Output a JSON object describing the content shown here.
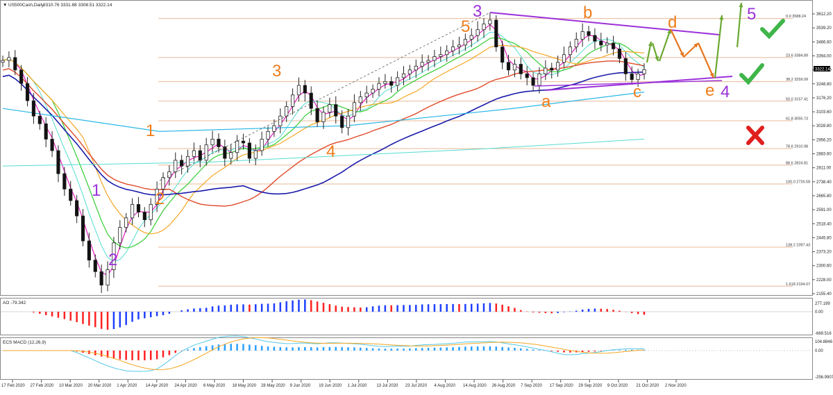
{
  "chart_data": {
    "type": "candlestick",
    "header": {
      "symbol": "US500Cash,Daily",
      "ohlc": "3310.76 3331.88 3308.51 3322.14"
    },
    "last_price": "3322.14",
    "y_ticks": [
      "3612.20",
      "3539.20",
      "3466.60",
      "3394.00",
      "3321.40",
      "3248.80",
      "3176.20",
      "3103.60",
      "3028.80",
      "2956.20",
      "2883.60",
      "2811.00",
      "2738.40",
      "2665.80",
      "2591.00",
      "2518.40",
      "2445.80",
      "2373.20",
      "2300.60",
      "2228.00",
      "2155.40"
    ],
    "ylim": [
      2155.4,
      3612.2
    ],
    "x_ticks": [
      "17 Feb 2020",
      "27 Feb 2020",
      "10 Mar 2020",
      "20 Mar 2020",
      "1 Apr 2020",
      "14 Apr 2020",
      "24 Apr 2020",
      "6 May 2020",
      "18 May 2020",
      "28 May 2020",
      "9 Jun 2020",
      "19 Jun 2020",
      "1 Jul 2020",
      "13 Jul 2020",
      "23 Jul 2020",
      "4 Aug 2020",
      "14 Aug 2020",
      "26 Aug 2020",
      "7 Sep 2020",
      "17 Sep 2020",
      "29 Sep 2020",
      "9 Oct 2020",
      "21 Oct 2020",
      "2 Nov 2020"
    ],
    "fib_levels": [
      {
        "label": "0.0 3588.24",
        "value": 3588.24
      },
      {
        "label": "23.6 3384.89",
        "value": 3384.89
      },
      {
        "label": "38.2 3259.09",
        "value": 3259.09
      },
      {
        "label": "50.0 3157.41",
        "value": 3157.41
      },
      {
        "label": "61.8 3055.73",
        "value": 3055.73
      },
      {
        "label": "78.6 2910.98",
        "value": 2910.98
      },
      {
        "label": "88.6 2824.81",
        "value": 2824.81
      },
      {
        "label": "100.0 2726.58",
        "value": 2726.58
      },
      {
        "label": "138.2 2397.43",
        "value": 2397.43
      },
      {
        "label": "1.618 2194.07",
        "value": 2194.07
      }
    ],
    "price_path": [
      3370,
      3385,
      3320,
      3250,
      3160,
      3080,
      3040,
      2960,
      2900,
      2780,
      2700,
      2640,
      2560,
      2430,
      2330,
      2270,
      2200,
      2280,
      2420,
      2500,
      2550,
      2620,
      2580,
      2540,
      2620,
      2700,
      2760,
      2790,
      2850,
      2820,
      2870,
      2900,
      2850,
      2930,
      2960,
      2920,
      2860,
      2890,
      2950,
      2940,
      2860,
      2900,
      2960,
      3000,
      3030,
      3080,
      3130,
      3190,
      3240,
      3200,
      3120,
      3050,
      3100,
      3140,
      3080,
      3020,
      3080,
      3150,
      3180,
      3200,
      3220,
      3250,
      3260,
      3240,
      3280,
      3300,
      3320,
      3340,
      3360,
      3370,
      3390,
      3400,
      3420,
      3440,
      3450,
      3480,
      3500,
      3530,
      3560,
      3580,
      3440,
      3360,
      3320,
      3350,
      3300,
      3280,
      3240,
      3300,
      3330,
      3320,
      3360,
      3400,
      3440,
      3480,
      3520,
      3500,
      3470,
      3450,
      3460,
      3430,
      3380,
      3300,
      3270,
      3300,
      3322
    ],
    "waves": [
      {
        "text": "1",
        "color": "#9b30d9"
      },
      {
        "text": "2",
        "color": "#9b30d9"
      },
      {
        "text": "1",
        "color": "#ee7d1b"
      },
      {
        "text": "2",
        "color": "#ee7d1b"
      },
      {
        "text": "3",
        "color": "#ee7d1b"
      },
      {
        "text": "4",
        "color": "#ee7d1b"
      },
      {
        "text": "5",
        "color": "#ee7d1b"
      },
      {
        "text": "3",
        "color": "#9b30d9"
      },
      {
        "text": "a",
        "color": "#ee7d1b"
      },
      {
        "text": "b",
        "color": "#ee7d1b"
      },
      {
        "text": "c",
        "color": "#ee7d1b"
      },
      {
        "text": "d",
        "color": "#ee7d1b"
      },
      {
        "text": "e",
        "color": "#ee7d1b"
      },
      {
        "text": "4",
        "color": "#9b30d9"
      },
      {
        "text": "5",
        "color": "#9b30d9"
      }
    ],
    "ao": {
      "label": "AO -79.342",
      "y_ticks": [
        "277.199",
        "0.00",
        "-669.516"
      ]
    },
    "macd": {
      "label": "ECS MACD (12,26,9)",
      "y_ticks": [
        "104.8846",
        "0.00",
        "-256.9907"
      ]
    },
    "colors": {
      "up_bar": "#1f3fff",
      "down_bar": "#ff2020",
      "ma_orange": "#f5a623",
      "ma_green": "#33cc33",
      "ma_blue": "#1a1aaa",
      "ma_cyan": "#29b6e6",
      "ma_teal": "#55dcd0",
      "ma_magenta": "#e020c0",
      "ma_red": "#e04a2a",
      "fib": "#e8b898",
      "wedge": "#9b30d9",
      "arrow_green": "#6aa832",
      "arrow_orange": "#e8741b",
      "check": "#3fb54a",
      "cross": "#e0201e"
    }
  }
}
